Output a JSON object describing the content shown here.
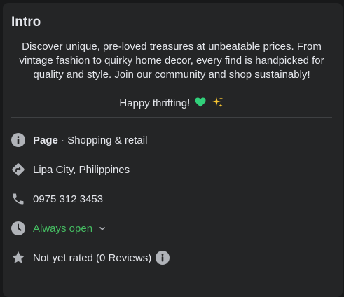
{
  "intro": {
    "title": "Intro",
    "bio": "Discover unique, pre-loved treasures at unbeatable prices. From vintage fashion to quirky home decor, every find is handpicked for quality and style. Join our community and shop sustainably!",
    "greeting": "Happy thrifting!",
    "greeting_emoji": [
      "green-heart",
      "sparkles"
    ]
  },
  "details": {
    "page_type_label": "Page",
    "page_category": " · Shopping & retail",
    "address": "Lipa City, Philippines",
    "phone": "0975 312 3453",
    "hours": "Always open",
    "rating": "Not yet rated (0 Reviews)"
  },
  "colors": {
    "background": "#242526",
    "text": "#e4e6eb",
    "icon": "#b0b3b8",
    "open_status": "#45bd62",
    "divider": "#3e4042"
  }
}
